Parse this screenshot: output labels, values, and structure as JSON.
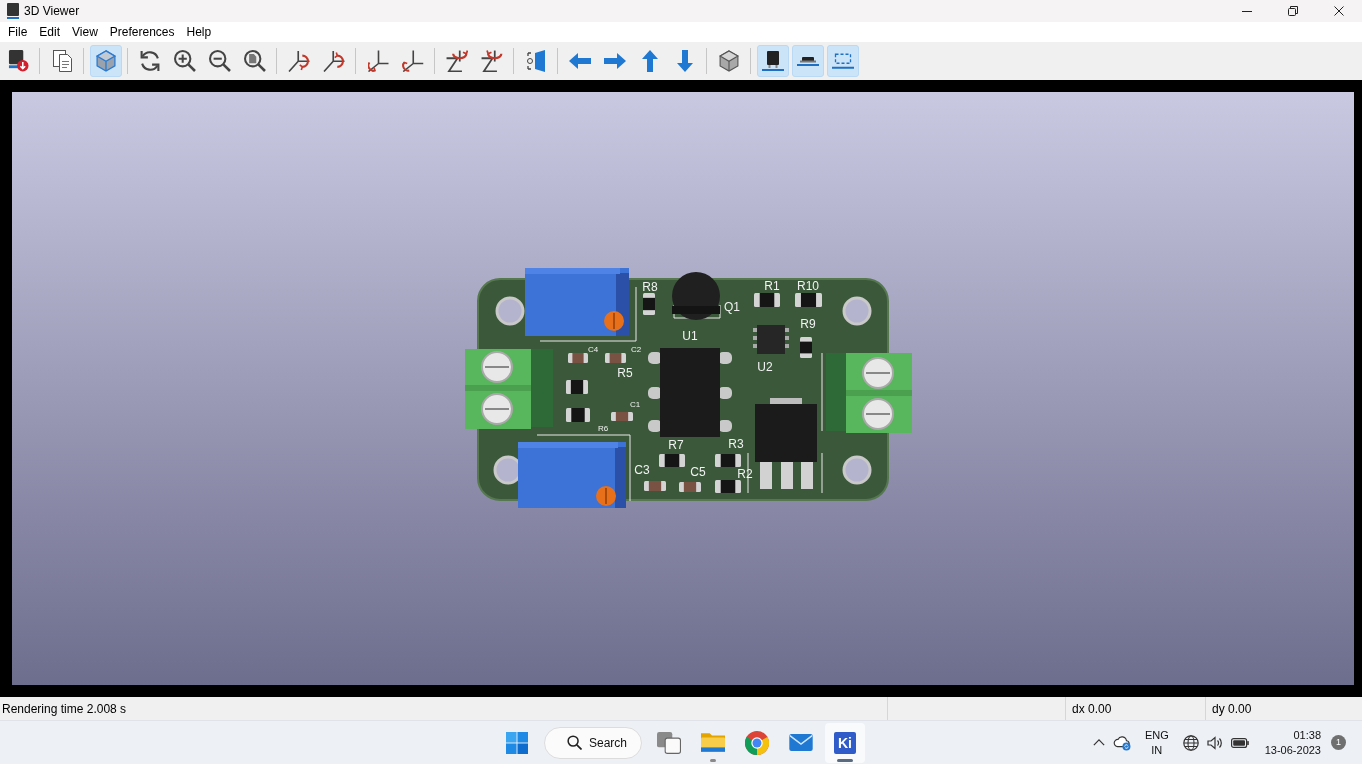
{
  "window": {
    "title": "3D Viewer"
  },
  "menu": [
    {
      "label": "File"
    },
    {
      "label": "Edit"
    },
    {
      "label": "View"
    },
    {
      "label": "Preferences"
    },
    {
      "label": "Help"
    }
  ],
  "toolbar": [
    [
      {
        "on": false
      }
    ],
    [
      {
        "on": false
      }
    ],
    [
      {
        "on": true
      }
    ],
    [
      {
        "on": false
      },
      {
        "on": false
      },
      {
        "on": false
      },
      {
        "on": false
      }
    ],
    [
      {
        "on": false
      },
      {
        "on": false
      }
    ],
    [
      {
        "on": false
      },
      {
        "on": false
      }
    ],
    [
      {
        "on": false
      },
      {
        "on": false
      }
    ],
    [
      {
        "on": false
      }
    ],
    [
      {
        "on": false
      },
      {
        "on": false
      },
      {
        "on": false
      },
      {
        "on": false
      }
    ],
    [
      {
        "on": false
      }
    ],
    [
      {
        "on": true
      },
      {
        "on": true
      },
      {
        "on": true
      }
    ]
  ],
  "viewport": {
    "board_labels": [
      "R8",
      "Q1",
      "U1",
      "R1",
      "R10",
      "R9",
      "U2",
      "C4",
      "C2",
      "R5",
      "C1",
      "R6",
      "R7",
      "R3",
      "C3",
      "C5",
      "R2"
    ]
  },
  "status_bar": {
    "message": "Rendering time 2.008 s",
    "fields": [
      "dx 0.00",
      "dy 0.00"
    ]
  },
  "taskbar": {
    "search": {
      "label": "Search"
    },
    "apps": [
      {
        "running": false,
        "selected": false
      },
      {
        "running": true,
        "selected": false
      },
      {
        "running": false,
        "selected": false
      },
      {
        "running": false,
        "selected": false
      },
      {
        "running": true,
        "selected": true,
        "logo": "Ki"
      }
    ],
    "language": [
      "ENG",
      "IN"
    ],
    "clock": {
      "time": "01:38",
      "date": "13-06-2023"
    },
    "notifications": "1"
  }
}
